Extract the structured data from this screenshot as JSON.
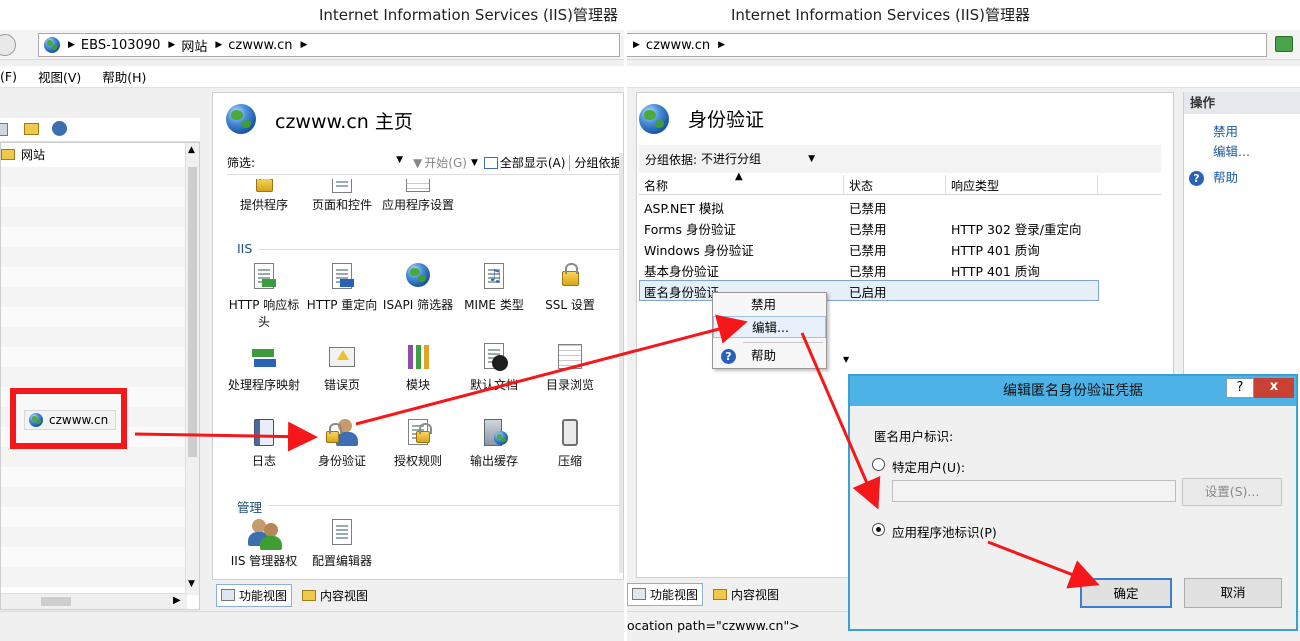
{
  "left_window": {
    "title": "Internet Information Services (IIS)管理器",
    "address": [
      "EBS-103090",
      "网站",
      "czwww.cn"
    ],
    "menu": [
      "(F)",
      "视图(V)",
      "帮助(H)"
    ],
    "tree_root": "网站",
    "tree_selected_node": "czwww.cn",
    "feature_title": "czwww.cn 主页",
    "filter": {
      "label": "筛选:",
      "go": "开始(G)",
      "show_all": "全部显示(A)",
      "group": "分组依据"
    },
    "top_row": [
      "提供程序",
      "页面和控件",
      "应用程序设置"
    ],
    "sections": {
      "iis": "IIS",
      "management": "管理"
    },
    "iis_row1": [
      "HTTP 响应标头",
      "HTTP 重定向",
      "ISAPI 筛选器",
      "MIME 类型",
      "SSL 设置"
    ],
    "iis_row2": [
      "处理程序映射",
      "错误页",
      "模块",
      "默认文档",
      "目录浏览"
    ],
    "iis_row3": [
      "日志",
      "身份验证",
      "授权规则",
      "输出缓存",
      "压缩"
    ],
    "mgmt_row": [
      "IIS 管理器权",
      "配置编辑器"
    ],
    "view_tabs": [
      "功能视图",
      "内容视图"
    ]
  },
  "right_window": {
    "title": "Internet Information Services (IIS)管理器",
    "address": [
      "czwww.cn"
    ],
    "pane_title": "身份验证",
    "group_label": "分组依据:",
    "group_value": "不进行分组",
    "columns": [
      "名称",
      "状态",
      "响应类型"
    ],
    "rows": [
      {
        "name": "ASP.NET 模拟",
        "status": "已禁用",
        "response": ""
      },
      {
        "name": "Forms 身份验证",
        "status": "已禁用",
        "response": "HTTP 302 登录/重定向"
      },
      {
        "name": "Windows 身份验证",
        "status": "已禁用",
        "response": "HTTP 401 质询"
      },
      {
        "name": "基本身份验证",
        "status": "已禁用",
        "response": "HTTP 401 质询"
      },
      {
        "name": "匿名身份验证",
        "status": "已启用",
        "response": ""
      }
    ],
    "actions": {
      "header": "操作",
      "items": [
        "禁用",
        "编辑...",
        "帮助"
      ]
    },
    "context_menu": [
      "禁用",
      "编辑...",
      "帮助"
    ],
    "view_tabs": [
      "功能视图",
      "内容视图"
    ],
    "status_text": "ocation path=\"czwww.cn\">"
  },
  "dialog": {
    "title": "编辑匿名身份验证凭据",
    "help_btn": "?",
    "close_btn": "x",
    "section_label": "匿名用户标识:",
    "option_specific": "特定用户(U):",
    "set_button": "设置(S)...",
    "option_pool": "应用程序池标识(P)",
    "ok": "确定",
    "cancel": "取消"
  },
  "colors": {
    "highlight_red": "#f5171a",
    "dialog_title_bg": "#4db3e6",
    "link_blue": "#1a5aa8"
  }
}
